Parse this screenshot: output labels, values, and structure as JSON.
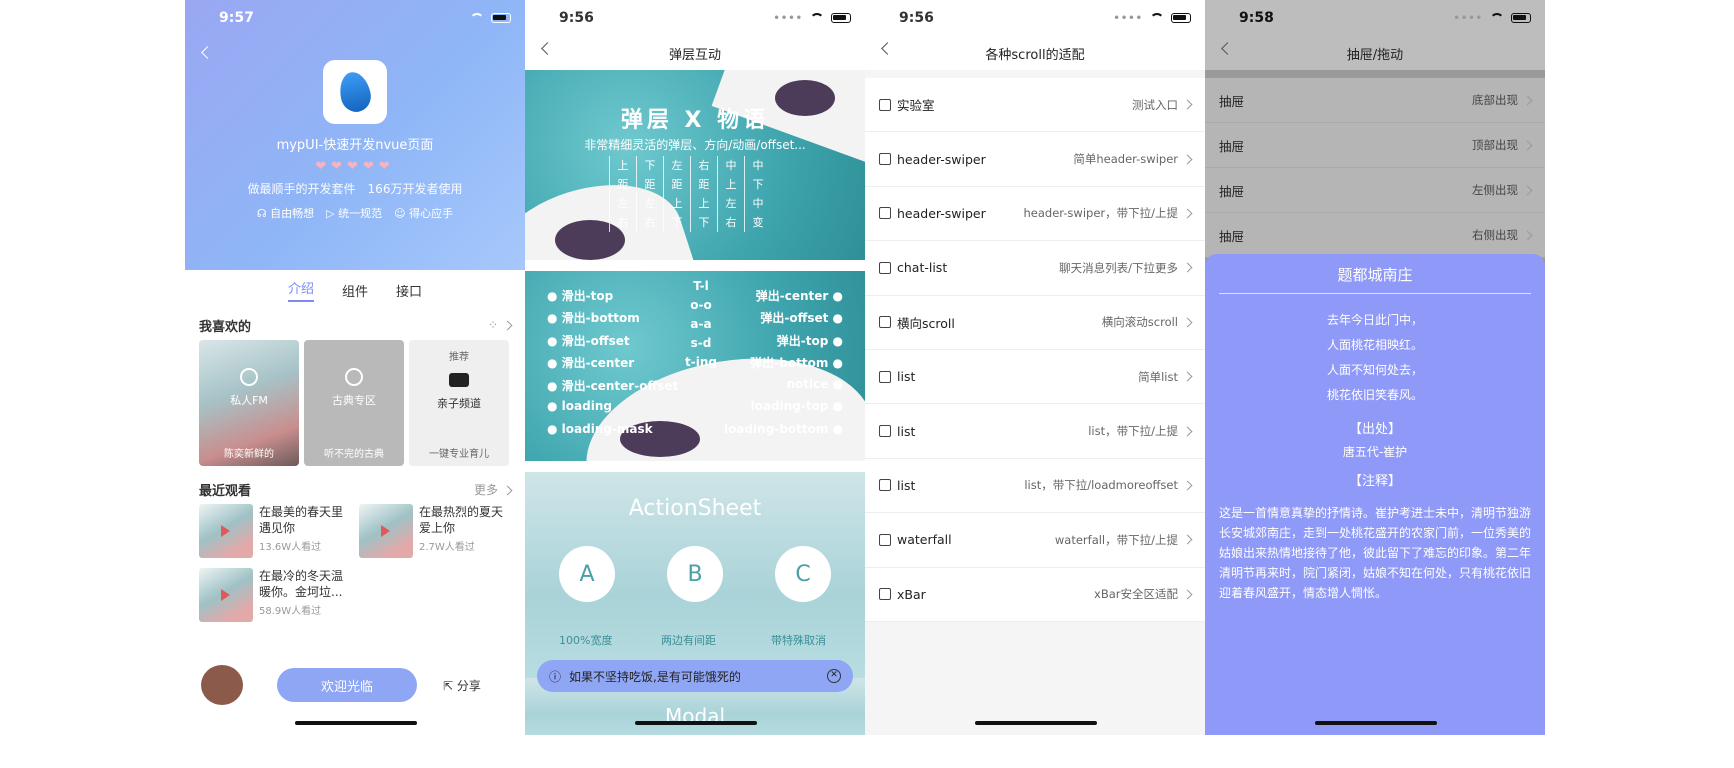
{
  "phone1": {
    "status_time": "9:57",
    "app_title": "mypUI-快速开发nvue页面",
    "stars": "❤❤❤❤❤",
    "subtitle": "做最顺手的开发套件　166万开发者使用",
    "tags": [
      "自由畅想",
      "统一规范",
      "得心应手"
    ],
    "tabs": [
      "介绍",
      "组件",
      "接口"
    ],
    "favorites_title": "我喜欢的",
    "cards": [
      {
        "title": "私人FM",
        "caption": "陈奕新鲜的"
      },
      {
        "title": "古典专区",
        "caption": "听不完的古典"
      },
      {
        "badge": "推荐",
        "title": "亲子频道",
        "caption": "一键专业育儿"
      }
    ],
    "recent_title": "最近观看",
    "recent_more": "更多",
    "recent": [
      {
        "title": "在最美的春天里遇见你",
        "views": "13.6W人看过"
      },
      {
        "title": "在最热烈的夏天爱上你",
        "views": "2.7W人看过"
      },
      {
        "title": "在最冷的冬天温暖你。金坷垃...",
        "views": "58.9W人看过"
      }
    ],
    "welcome_button": "欢迎光临",
    "share_button": "分享"
  },
  "phone2": {
    "status_time": "9:56",
    "title": "弹层互动",
    "banner1": {
      "title": "弹层 X 物语",
      "subtitle": "非常精细灵活的弹层、方向/动画/offset...",
      "columns": [
        [
          "上",
          "距",
          "左",
          "右"
        ],
        [
          "下",
          "距",
          "左",
          "右"
        ],
        [
          "左",
          "距",
          "上",
          "下"
        ],
        [
          "右",
          "距",
          "上",
          "下"
        ],
        [
          "中",
          "上",
          "左",
          "右"
        ],
        [
          "中",
          "下",
          "中",
          "变"
        ]
      ]
    },
    "banner2": {
      "left": [
        "滑出-top",
        "滑出-bottom",
        "滑出-offset",
        "滑出-center",
        "滑出-center-offset",
        "loading",
        "loading-mask"
      ],
      "right": [
        "弹出-center",
        "弹出-offset",
        "弹出-top",
        "弹出-bottom",
        "notice",
        "loading-top",
        "loading-bottom"
      ],
      "center": [
        "T-l",
        "o-o",
        "a-a",
        "s-d",
        "t-ing"
      ]
    },
    "banner3": {
      "title": "ActionSheet",
      "circles": [
        {
          "letter": "A",
          "caption": "100%宽度"
        },
        {
          "letter": "B",
          "caption": "两边有间距"
        },
        {
          "letter": "C",
          "caption": "带特殊取消"
        }
      ]
    },
    "banner4_title": "Modal",
    "toast": "如果不坚持吃饭,是有可能饿死的"
  },
  "phone3": {
    "status_time": "9:56",
    "title": "各种scroll的适配",
    "rows": [
      {
        "icon": "lab-icon",
        "label": "实验室",
        "value": "测试入口"
      },
      {
        "icon": "headphone-icon",
        "label": "header-swiper",
        "value": "简单header-swiper"
      },
      {
        "icon": "headphone-icon",
        "label": "header-swiper",
        "value": "header-swiper，带下拉/上提"
      },
      {
        "icon": "calendar-icon",
        "label": "chat-list",
        "value": "聊天消息列表/下拉更多"
      },
      {
        "icon": "book-icon",
        "label": "横向scroll",
        "value": "横向滚动scroll"
      },
      {
        "icon": "hash-icon",
        "label": "list",
        "value": "简单list"
      },
      {
        "icon": "hash-icon",
        "label": "list",
        "value": "list，带下拉/上提"
      },
      {
        "icon": "hash-icon",
        "label": "list",
        "value": "list，带下拉/loadmoreoffset"
      },
      {
        "icon": "grid-icon",
        "label": "waterfall",
        "value": "waterfall，带下拉/上提"
      },
      {
        "icon": "bar-icon",
        "label": "xBar",
        "value": "xBar安全区适配"
      }
    ]
  },
  "phone4": {
    "status_time": "9:58",
    "title": "抽屉/拖动",
    "rows": [
      {
        "label": "抽屉",
        "value": "底部出现"
      },
      {
        "label": "抽屉",
        "value": "顶部出现"
      },
      {
        "label": "抽屉",
        "value": "左侧出现"
      },
      {
        "label": "抽屉",
        "value": "右侧出现"
      }
    ],
    "drawer": {
      "title": "题都城南庄",
      "poem": [
        "去年今日此门中，",
        "人面桃花相映红。",
        "人面不知何处去，",
        "桃花依旧笑春风。"
      ],
      "source_head": "【出处】",
      "author": "唐五代-崔护",
      "note_head": "【注释】",
      "note": "这是一首情意真挚的抒情诗。崔护考进士未中，清明节独游长安城郊南庄，走到一处桃花盛开的农家门前，一位秀美的姑娘出来热情地接待了他，彼此留下了难忘的印象。第二年清明节再来时，院门紧闭，姑娘不知在何处，只有桃花依旧迎着春风盛开，情态增人惆怅。"
    }
  }
}
